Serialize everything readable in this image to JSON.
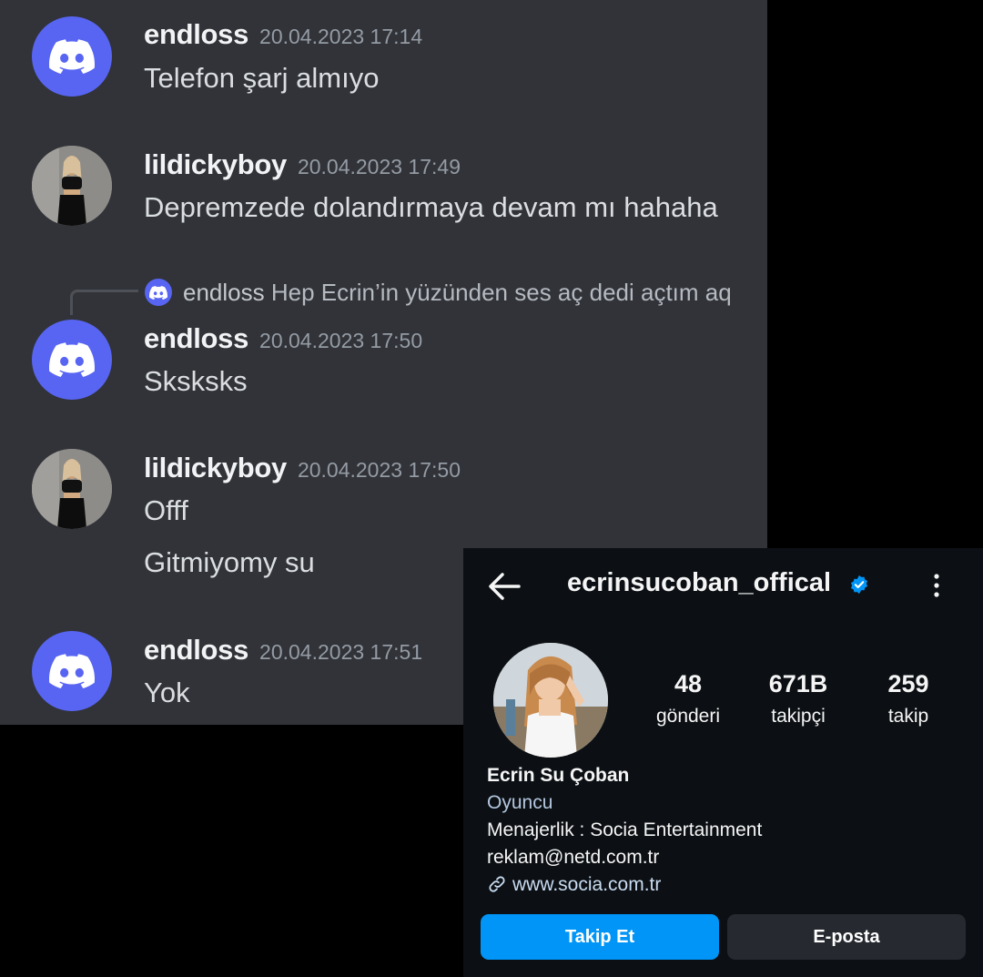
{
  "discord": {
    "messages": [
      {
        "username": "endloss",
        "timestamp": "20.04.2023 17:14",
        "lines": [
          "Telefon şarj almıyo"
        ],
        "avatar": "discord-logo"
      },
      {
        "username": "lildickyboy",
        "timestamp": "20.04.2023 17:49",
        "lines": [
          "Depremzede dolandırmaya devam mı hahaha"
        ],
        "avatar": "photo"
      },
      {
        "username": "endloss",
        "timestamp": "20.04.2023 17:50",
        "lines": [
          "Sksksks"
        ],
        "avatar": "discord-logo",
        "reply": {
          "username": "endloss",
          "text": "Hep Ecrin’in yüzünden ses aç dedi açtım aq"
        }
      },
      {
        "username": "lildickyboy",
        "timestamp": "20.04.2023 17:50",
        "lines": [
          "Offf",
          "Gitmiyomy su"
        ],
        "avatar": "photo"
      },
      {
        "username": "endloss",
        "timestamp": "20.04.2023 17:51",
        "lines": [
          "Yok"
        ],
        "avatar": "discord-logo"
      }
    ],
    "colors": {
      "background": "#313338",
      "blurple": "#5865F2"
    }
  },
  "instagram": {
    "username": "ecrinsucoban_offical",
    "verified": true,
    "stats": [
      {
        "value": "48",
        "label": "gönderi"
      },
      {
        "value": "671B",
        "label": "takipçi"
      },
      {
        "value": "259",
        "label": "takip"
      }
    ],
    "name": "Ecrin Su Çoban",
    "category": "Oyuncu",
    "bio_lines": [
      "Menajerlik : Socia Entertainment",
      "reklam@netd.com.tr"
    ],
    "link": "www.socia.com.tr",
    "buttons": {
      "follow": "Takip Et",
      "email": "E-posta"
    },
    "colors": {
      "background": "#0c1014",
      "primary": "#0095f6",
      "verified": "#0095f6"
    }
  }
}
